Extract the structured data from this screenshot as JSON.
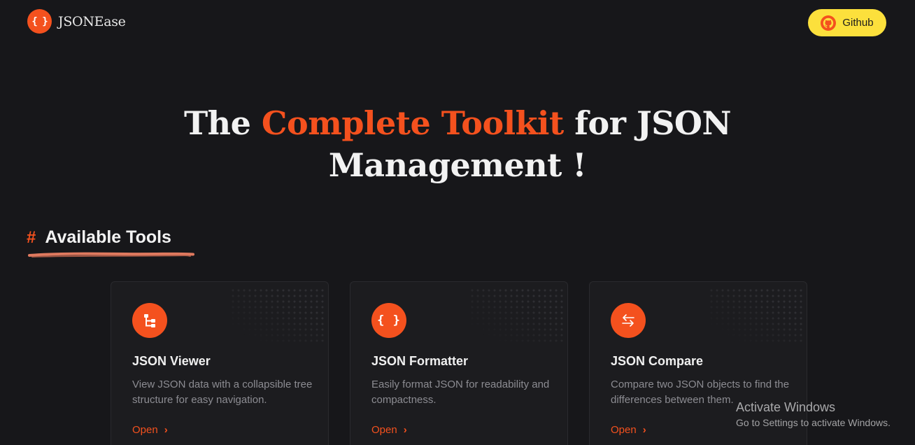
{
  "header": {
    "logo_mark": "{ }",
    "logo_text": "JSONEase",
    "github_label": "Github"
  },
  "hero": {
    "part1": "The ",
    "accent": "Complete Toolkit",
    "part2": " for JSON",
    "line2": "Management !"
  },
  "section": {
    "hash": "#",
    "title": "Available Tools"
  },
  "tools": [
    {
      "icon": "tree-structure-icon",
      "title": "JSON Viewer",
      "description": "View JSON data with a collapsible tree structure for easy navigation.",
      "link": "Open"
    },
    {
      "icon": "braces-icon",
      "icon_text": "{ }",
      "title": "JSON Formatter",
      "description": "Easily format JSON for readability and compactness.",
      "link": "Open"
    },
    {
      "icon": "compare-arrows-icon",
      "title": "JSON Compare",
      "description": "Compare two JSON objects to find the differences between them.",
      "link": "Open"
    }
  ],
  "watermark": {
    "title": "Activate Windows",
    "subtitle": "Go to Settings to activate Windows."
  },
  "colors": {
    "accent": "#f4511e",
    "github_button": "#fce03c",
    "background": "#17171a",
    "card": "#1c1c1f"
  }
}
